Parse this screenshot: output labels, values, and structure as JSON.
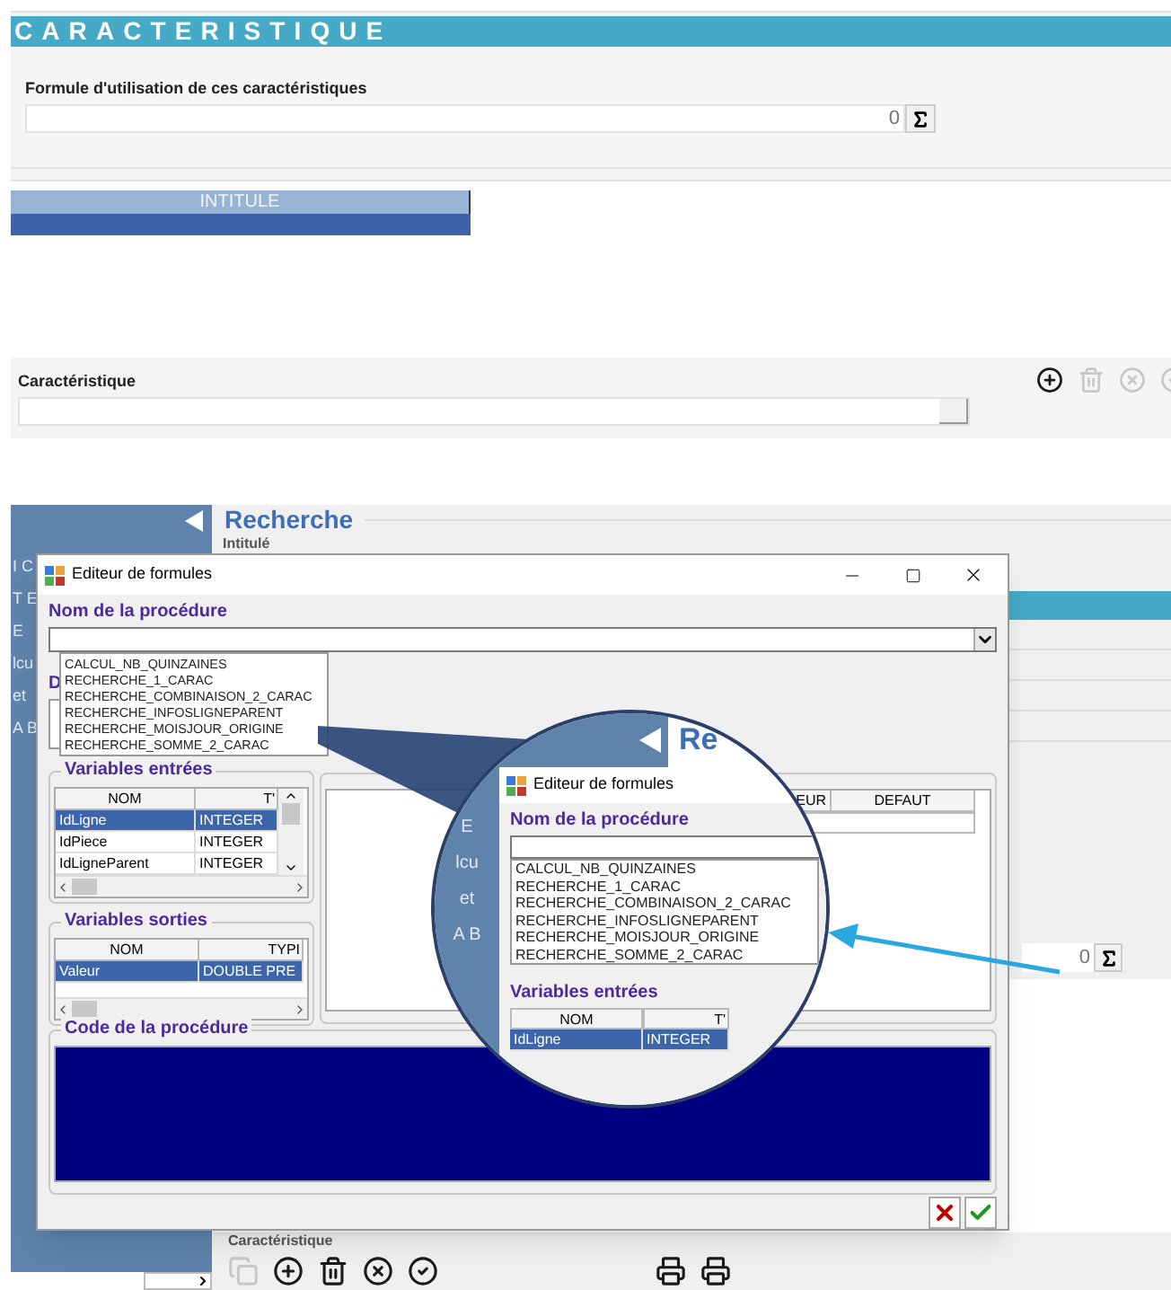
{
  "header": {
    "title": "CARACTERISTIQUE"
  },
  "formula": {
    "label": "Formule d'utilisation de ces caractéristiques",
    "value": "0"
  },
  "grid": {
    "columns": [
      "INTITULE"
    ]
  },
  "characteristic": {
    "label": "Caractéristique",
    "toolbar": [
      {
        "kind": "add",
        "disabled": false
      },
      {
        "kind": "delete",
        "disabled": true
      },
      {
        "kind": "cancel",
        "disabled": true
      },
      {
        "kind": "validate",
        "disabled": true
      }
    ]
  },
  "background_app": {
    "sidebar_fragments": [
      "I C",
      "T E",
      "E",
      "lcu",
      "et",
      "A B"
    ],
    "title": "Recherche",
    "field_label": "Intitulé",
    "formula_value": "0",
    "footer_label": "Caractéristique",
    "toolbar": [
      {
        "kind": "copy",
        "disabled": true
      },
      {
        "kind": "add",
        "disabled": false
      },
      {
        "kind": "delete",
        "disabled": false
      },
      {
        "kind": "cancel",
        "disabled": false
      },
      {
        "kind": "validate",
        "disabled": false
      },
      {
        "kind": "print",
        "disabled": false
      },
      {
        "kind": "print-preview",
        "disabled": false
      }
    ]
  },
  "dialog": {
    "title": "Editeur de formules",
    "procedure_label": "Nom de la procédure",
    "procedures": [
      "CALCUL_NB_QUINZAINES",
      "RECHERCHE_1_CARAC",
      "RECHERCHE_COMBINAISON_2_CARAC",
      "RECHERCHE_INFOSLIGNEPARENT",
      "RECHERCHE_MOISJOUR_ORIGINE",
      "RECHERCHE_SOMME_2_CARAC"
    ],
    "hidden_label": "D",
    "inputs": {
      "title": "Variables entrées",
      "columns": [
        "NOM",
        "T'"
      ],
      "rows": [
        {
          "cells": [
            "IdLigne",
            "INTEGER"
          ],
          "selected": true
        },
        {
          "cells": [
            "IdPiece",
            "INTEGER"
          ],
          "selected": false
        },
        {
          "cells": [
            "IdLigneParent",
            "INTEGER"
          ],
          "selected": false
        }
      ]
    },
    "outputs": {
      "title": "Variables sorties",
      "columns": [
        "NOM",
        "TYPI"
      ],
      "rows": [
        {
          "cells": [
            "Valeur",
            "DOUBLE PRE"
          ],
          "selected": true
        }
      ]
    },
    "locals": {
      "columns": [
        "EUR",
        "DEFAUT"
      ]
    },
    "code_label": "Code de la procédure"
  },
  "magnifier": {
    "header_fragment": "Re",
    "sidebar_fragments": [
      "E",
      "lcu",
      "et",
      "A B"
    ],
    "title": "Editeur de formules",
    "procedure_label": "Nom de la procédure",
    "procedures": [
      "CALCUL_NB_QUINZAINES",
      "RECHERCHE_1_CARAC",
      "RECHERCHE_COMBINAISON_2_CARAC",
      "RECHERCHE_INFOSLIGNEPARENT",
      "RECHERCHE_MOISJOUR_ORIGINE",
      "RECHERCHE_SOMME_2_CARAC"
    ],
    "inputs_title": "Variables entrées",
    "columns": [
      "NOM",
      "T'"
    ],
    "rows": [
      {
        "cells": [
          "IdLigne",
          "INTEGER"
        ],
        "selected": true
      }
    ]
  }
}
